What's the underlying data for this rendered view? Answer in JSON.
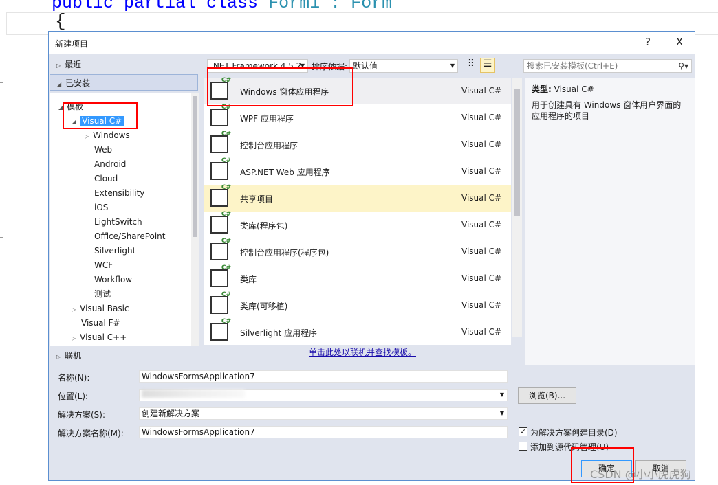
{
  "editor": {
    "code_kw": "public partial class ",
    "code_type": "Form1 : Form",
    "brace": "{"
  },
  "dialog": {
    "title": "新建项目",
    "help": "?",
    "close": "X"
  },
  "nav": {
    "recent": "最近",
    "installed": "已安装",
    "online": "联机"
  },
  "tree": [
    {
      "label": "模板",
      "level": 0,
      "expanded": true
    },
    {
      "label": "Visual C#",
      "level": 1,
      "expanded": true,
      "selected": true
    },
    {
      "label": "Windows",
      "level": 2,
      "collapsed": true
    },
    {
      "label": "Web",
      "level": 2
    },
    {
      "label": "Android",
      "level": 2
    },
    {
      "label": "Cloud",
      "level": 2
    },
    {
      "label": "Extensibility",
      "level": 2
    },
    {
      "label": "iOS",
      "level": 2
    },
    {
      "label": "LightSwitch",
      "level": 2
    },
    {
      "label": "Office/SharePoint",
      "level": 2
    },
    {
      "label": "Silverlight",
      "level": 2
    },
    {
      "label": "WCF",
      "level": 2
    },
    {
      "label": "Workflow",
      "level": 2
    },
    {
      "label": "测试",
      "level": 2
    },
    {
      "label": "Visual Basic",
      "level": 1,
      "collapsed": true
    },
    {
      "label": "Visual F#",
      "level": 1
    },
    {
      "label": "Visual C++",
      "level": 1,
      "collapsed": true
    }
  ],
  "toolbar": {
    "framework": ".NET Framework 4.5.2",
    "sort_label": "排序依据:",
    "sort_value": "默认值",
    "search_placeholder": "搜索已安装模板(Ctrl+E)"
  },
  "templates": [
    {
      "name": "Windows 窗体应用程序",
      "lang": "Visual C#",
      "state": "selected"
    },
    {
      "name": "WPF 应用程序",
      "lang": "Visual C#"
    },
    {
      "name": "控制台应用程序",
      "lang": "Visual C#"
    },
    {
      "name": "ASP.NET Web 应用程序",
      "lang": "Visual C#"
    },
    {
      "name": "共享项目",
      "lang": "Visual C#",
      "state": "hover"
    },
    {
      "name": "类库(程序包)",
      "lang": "Visual C#"
    },
    {
      "name": "控制台应用程序(程序包)",
      "lang": "Visual C#"
    },
    {
      "name": "类库",
      "lang": "Visual C#"
    },
    {
      "name": "类库(可移植)",
      "lang": "Visual C#"
    },
    {
      "name": "Silverlight 应用程序",
      "lang": "Visual C#"
    }
  ],
  "online_link": "单击此处以联机并查找模板。",
  "details": {
    "type_label": "类型:",
    "type_value": "Visual C#",
    "description": "用于创建具有 Windows 窗体用户界面的应用程序的项目"
  },
  "form": {
    "name_label": "名称(N):",
    "name_value": "WindowsFormsApplication7",
    "location_label": "位置(L):",
    "solution_label": "解决方案(S):",
    "solution_value": "创建新解决方案",
    "solution_name_label": "解决方案名称(M):",
    "solution_name_value": "WindowsFormsApplication7",
    "browse": "浏览(B)...",
    "create_dir_label": "为解决方案创建目录(D)",
    "create_dir_checked": true,
    "source_control_label": "添加到源代码管理(U)",
    "source_control_checked": false,
    "ok": "确定",
    "cancel": "取消"
  },
  "watermark": "CSDN @小小虎虎狗",
  "colors": {
    "annotation": "#ff0000",
    "hover": "#fdf4c8",
    "accent": "#3399ff"
  }
}
